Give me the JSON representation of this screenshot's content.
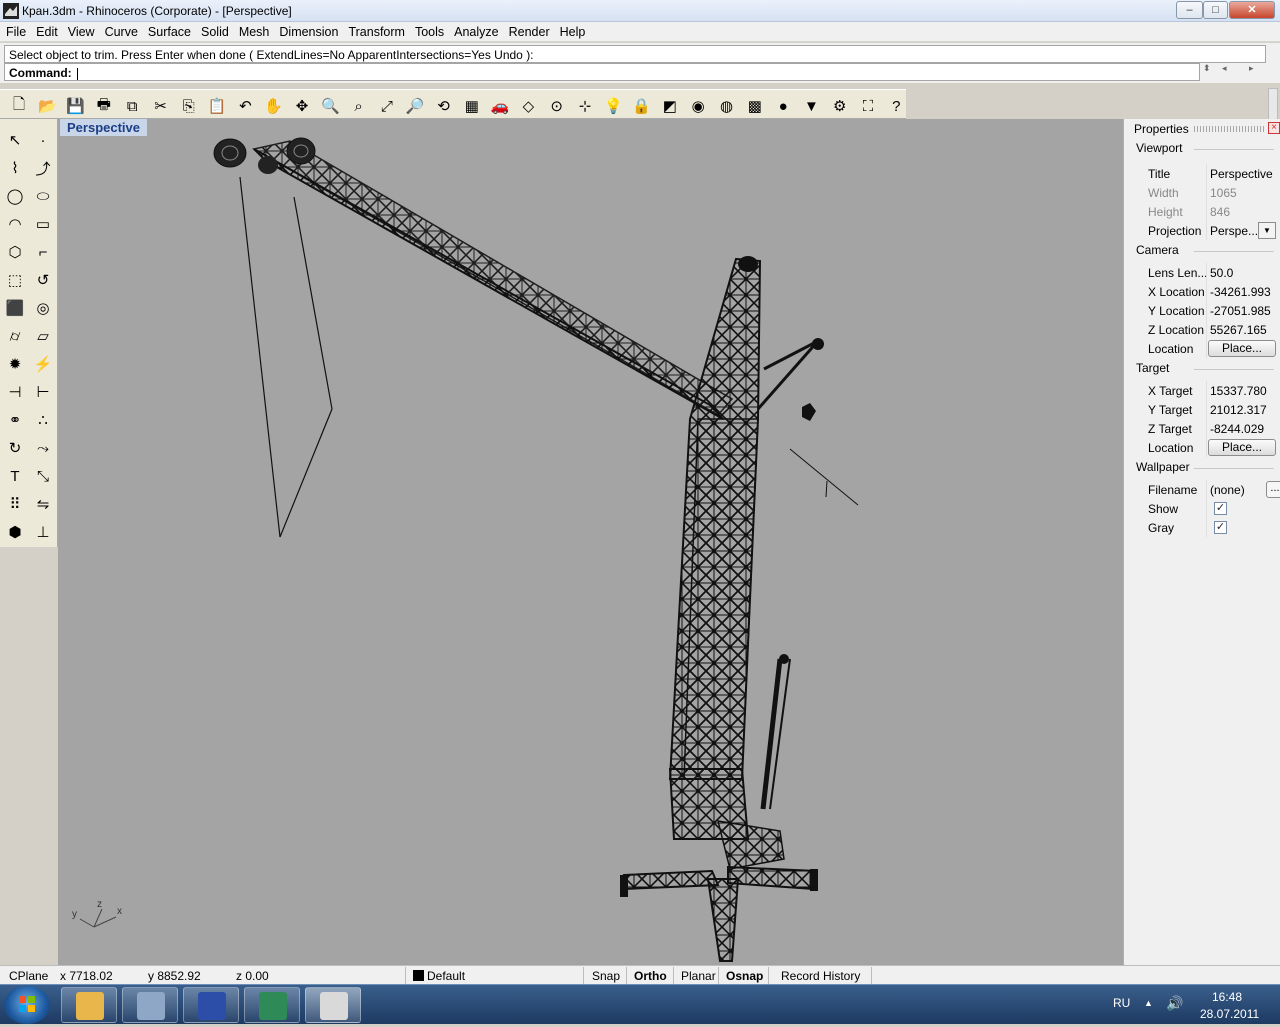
{
  "window": {
    "title": "Кран.3dm - Rhinoceros (Corporate) - [Perspective]",
    "minimize": "–",
    "maximize": "□",
    "close": "✕"
  },
  "menu": [
    "File",
    "Edit",
    "View",
    "Curve",
    "Surface",
    "Solid",
    "Mesh",
    "Dimension",
    "Transform",
    "Tools",
    "Analyze",
    "Render",
    "Help"
  ],
  "command": {
    "history": "Select object to trim. Press Enter when done ( ExtendLines=No  ApparentIntersections=Yes  Undo ):",
    "prompt": "Command:",
    "value": ""
  },
  "toolbar": {
    "icons": [
      "new-file-icon",
      "open-folder-icon",
      "save-icon",
      "print-icon",
      "import-icon",
      "cut-icon",
      "copy-icon",
      "paste-icon",
      "undo-icon",
      "pan-hand-icon",
      "rotate-view-icon",
      "zoom-icon",
      "zoom-window-icon",
      "zoom-extents-icon",
      "zoom-selected-icon",
      "undo-view-icon",
      "four-viewports-icon",
      "car-render-icon",
      "grid-plane-icon",
      "cplane-icon",
      "snap-points-icon",
      "light-bulb-icon",
      "lock-icon",
      "layer-icon",
      "color-wheel-icon",
      "wireframe-sphere-icon",
      "render-mesh-icon",
      "shaded-sphere-icon",
      "filter-icon",
      "gear-icon",
      "dimension-tool-icon",
      "help-icon"
    ],
    "glyphs": [
      "🗋",
      "📂",
      "💾",
      "🖶",
      "⧉",
      "✂",
      "⎘",
      "📋",
      "↶",
      "✋",
      "✥",
      "🔍",
      "⌕",
      "⤢",
      "🔎",
      "⟲",
      "▦",
      "🚗",
      "◇",
      "⊙",
      "⊹",
      "💡",
      "🔒",
      "◩",
      "◉",
      "◍",
      "▩",
      "●",
      "▼",
      "⚙",
      "⛶",
      "?"
    ]
  },
  "left_tools": [
    {
      "icon": "select-arrow-icon",
      "g": "↖"
    },
    {
      "icon": "point-icon",
      "g": "·"
    },
    {
      "icon": "polyline-icon",
      "g": "⌇"
    },
    {
      "icon": "curve-edit-icon",
      "g": "⤴"
    },
    {
      "icon": "circle-icon",
      "g": "◯"
    },
    {
      "icon": "ellipse-icon",
      "g": "⬭"
    },
    {
      "icon": "arc-icon",
      "g": "◠"
    },
    {
      "icon": "rectangle-icon",
      "g": "▭"
    },
    {
      "icon": "polygon-icon",
      "g": "⬡"
    },
    {
      "icon": "fillet-curve-icon",
      "g": "⌐"
    },
    {
      "icon": "surface-corner-icon",
      "g": "⬚"
    },
    {
      "icon": "revolve-icon",
      "g": "↺"
    },
    {
      "icon": "box-solid-icon",
      "g": "⬛"
    },
    {
      "icon": "boolean-icon",
      "g": "◎"
    },
    {
      "icon": "cylinder-icon",
      "g": "⌭"
    },
    {
      "icon": "plane-surface-icon",
      "g": "▱"
    },
    {
      "icon": "explode-icon",
      "g": "✹"
    },
    {
      "icon": "trim-icon",
      "g": "⚡"
    },
    {
      "icon": "split-icon",
      "g": "⊣"
    },
    {
      "icon": "extend-icon",
      "g": "⊢"
    },
    {
      "icon": "group-icon",
      "g": "⚭"
    },
    {
      "icon": "join-icon",
      "g": "∴"
    },
    {
      "icon": "rotate-tool-icon",
      "g": "↻"
    },
    {
      "icon": "move-icon",
      "g": "⤳"
    },
    {
      "icon": "text-icon",
      "g": "T"
    },
    {
      "icon": "scale-icon",
      "g": "⤡"
    },
    {
      "icon": "array-icon",
      "g": "⠿"
    },
    {
      "icon": "mirror-icon",
      "g": "⇋"
    },
    {
      "icon": "block-icon",
      "g": "⬢"
    },
    {
      "icon": "dimension-icon",
      "g": "⊥"
    }
  ],
  "viewport": {
    "title": "Perspective",
    "axes": {
      "y": "y",
      "z": "z",
      "x": "x"
    }
  },
  "properties": {
    "title": "Properties",
    "close": "×",
    "sections": {
      "viewport": "Viewport",
      "camera": "Camera",
      "target": "Target",
      "wallpaper": "Wallpaper"
    },
    "viewport_rows": [
      {
        "k": "Title",
        "v": "Perspective"
      },
      {
        "k": "Width",
        "v": "1065"
      },
      {
        "k": "Height",
        "v": "846"
      },
      {
        "k": "Projection",
        "v": "Perspe..."
      }
    ],
    "camera_rows": [
      {
        "k": "Lens Len...",
        "v": "50.0"
      },
      {
        "k": "X Location",
        "v": "-34261.993"
      },
      {
        "k": "Y Location",
        "v": "-27051.985"
      },
      {
        "k": "Z Location",
        "v": "55267.165"
      },
      {
        "k": "Location",
        "v": "Place..."
      }
    ],
    "target_rows": [
      {
        "k": "X Target",
        "v": "15337.780"
      },
      {
        "k": "Y Target",
        "v": "21012.317"
      },
      {
        "k": "Z Target",
        "v": "-8244.029"
      },
      {
        "k": "Location",
        "v": "Place..."
      }
    ],
    "wallpaper_rows": [
      {
        "k": "Filename",
        "v": "(none)",
        "btn": "..."
      },
      {
        "k": "Show",
        "checked": true
      },
      {
        "k": "Gray",
        "checked": true
      }
    ],
    "dropdown_glyph": "▼",
    "check_glyph": "✓"
  },
  "status": {
    "cplane": "CPlane",
    "x": "x 7718.02",
    "y": "y 8852.92",
    "z": "z 0.00",
    "layer": "Default",
    "layer_color": "#000000",
    "snap": "Snap",
    "ortho": "Ortho",
    "planar": "Planar",
    "osnap": "Osnap",
    "record": "Record History"
  },
  "taskbar": {
    "apps": [
      "file-explorer-icon",
      "calculator-icon",
      "save-disk-icon",
      "autocad-icon",
      "rhino-icon"
    ],
    "lang": "RU",
    "time": "16:48",
    "date": "28.07.2011"
  },
  "colors": {
    "viewport_bg": "#a4a4a4",
    "viewport_title_fg": "#1b3f86",
    "model": "#111111"
  }
}
